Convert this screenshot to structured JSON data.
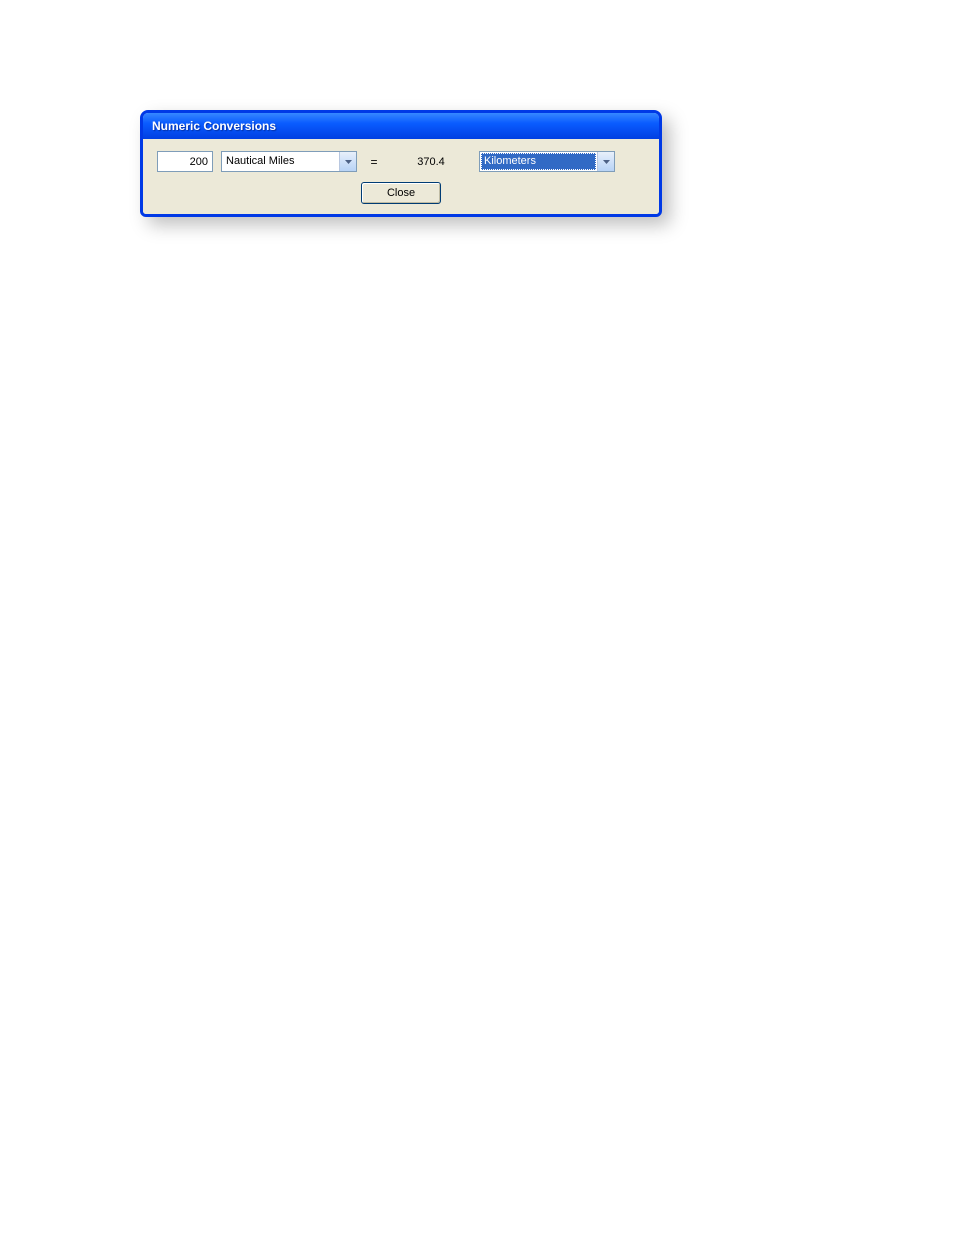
{
  "window": {
    "title": "Numeric Conversions"
  },
  "conversion": {
    "input_value": "200",
    "from_unit": "Nautical Miles",
    "equals": "=",
    "result_value": "370.4",
    "to_unit": "Kilometers"
  },
  "buttons": {
    "close": "Close"
  }
}
